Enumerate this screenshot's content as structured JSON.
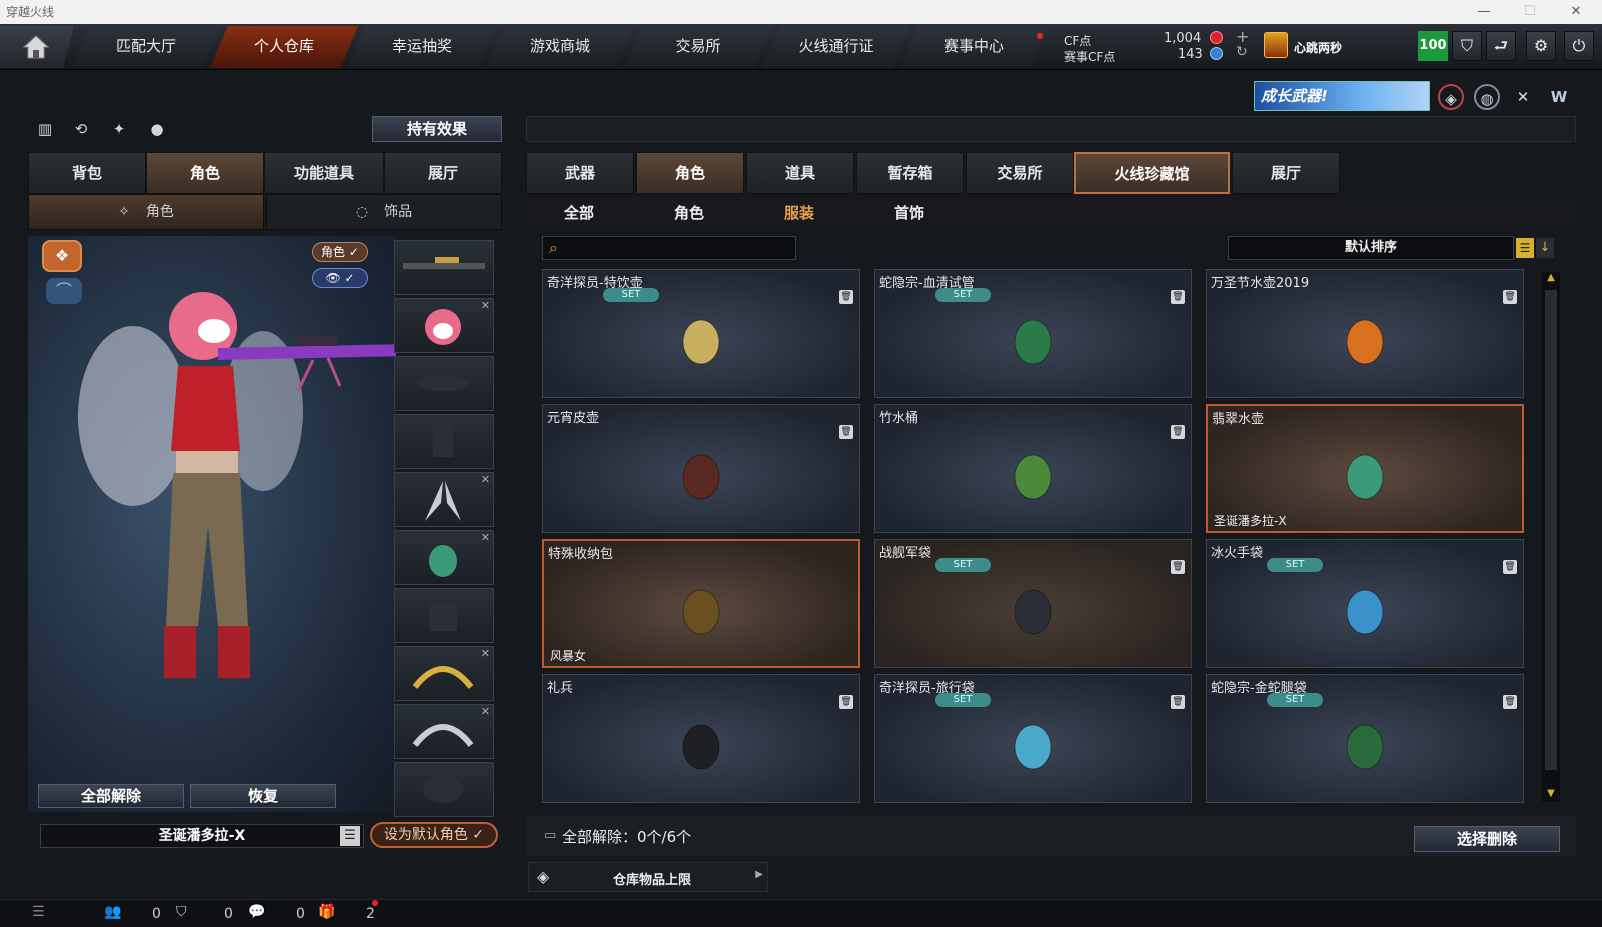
{
  "window": {
    "title": "穿越火线"
  },
  "nav": {
    "tabs": [
      {
        "label": "匹配大厅"
      },
      {
        "label": "个人仓库"
      },
      {
        "label": "幸运抽奖"
      },
      {
        "label": "游戏商城"
      },
      {
        "label": "交易所"
      },
      {
        "label": "火线通行证"
      },
      {
        "label": "赛事中心"
      }
    ]
  },
  "currency": {
    "cf_label": "CF点",
    "cf_value": "1,004",
    "event_label": "赛事CF点",
    "event_value": "143"
  },
  "user": {
    "name": "心跳两秒",
    "level": "100"
  },
  "banner": {
    "text": "成长武器!"
  },
  "left": {
    "effect_button": "持有效果",
    "tabs": [
      {
        "label": "背包"
      },
      {
        "label": "角色"
      },
      {
        "label": "功能道具"
      },
      {
        "label": "展厅"
      }
    ],
    "subtabs": [
      {
        "label": "角色"
      },
      {
        "label": "饰品"
      }
    ],
    "toggle_role": "角色",
    "btn_release_all": "全部解除",
    "btn_restore": "恢复",
    "character_name": "圣诞潘多拉-X",
    "btn_set_default": "设为默认角色"
  },
  "right": {
    "tabs": [
      {
        "label": "武器"
      },
      {
        "label": "角色"
      },
      {
        "label": "道具"
      },
      {
        "label": "暂存箱"
      },
      {
        "label": "交易所"
      },
      {
        "label": "火线珍藏馆"
      },
      {
        "label": "展厅"
      }
    ],
    "filters": [
      {
        "label": "全部"
      },
      {
        "label": "角色"
      },
      {
        "label": "服装"
      },
      {
        "label": "首饰"
      }
    ],
    "sort_label": "默认排序",
    "items": [
      {
        "name": "奇洋探员-特饮壶",
        "set": "SET",
        "owner": ""
      },
      {
        "name": "蛇隐宗-血清试管",
        "set": "SET",
        "owner": ""
      },
      {
        "name": "万圣节水壶2019",
        "set": "",
        "owner": ""
      },
      {
        "name": "元宵皮壶",
        "set": "",
        "owner": ""
      },
      {
        "name": "竹水桶",
        "set": "",
        "owner": ""
      },
      {
        "name": "翡翠水壶",
        "set": "",
        "owner": "圣诞潘多拉-X"
      },
      {
        "name": "特殊收纳包",
        "set": "",
        "owner": "风暴女"
      },
      {
        "name": "战舰军袋",
        "set": "SET",
        "owner": ""
      },
      {
        "name": "冰火手袋",
        "set": "SET",
        "owner": ""
      },
      {
        "name": "礼兵",
        "set": "",
        "owner": ""
      },
      {
        "name": "奇洋探员-旅行袋",
        "set": "SET",
        "owner": ""
      },
      {
        "name": "蛇隐宗-金蛇腿袋",
        "set": "SET",
        "owner": ""
      }
    ],
    "release_status": "全部解除：0个/6个",
    "btn_select_delete": "选择删除",
    "storage_limit": "仓库物品上限"
  },
  "bottom": {
    "count1": "0",
    "count2": "0",
    "count3": "0",
    "count4": "2"
  },
  "colors": {
    "accent": "#c05a30",
    "set_badge": "#3d8c8a",
    "active_nav": "#8a2e12"
  }
}
